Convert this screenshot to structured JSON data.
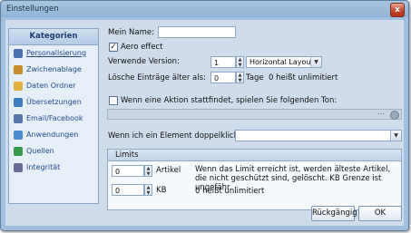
{
  "window": {
    "title": "Einstellungen",
    "close_glyph": "x"
  },
  "sidebar": {
    "header": "Kategorien",
    "items": [
      {
        "label": "Personalisierung",
        "icon": "user-icon",
        "color": "#4a6fb0"
      },
      {
        "label": "Zwichenablage",
        "icon": "clipboard-icon",
        "color": "#c98f2c"
      },
      {
        "label": "Daten Ordner",
        "icon": "folder-icon",
        "color": "#e0b040"
      },
      {
        "label": "Übersetzungen",
        "icon": "translate-icon",
        "color": "#3f7cc4"
      },
      {
        "label": "Email/Facebook",
        "icon": "email-icon",
        "color": "#5577aa"
      },
      {
        "label": "Anwendungen",
        "icon": "applications-icon",
        "color": "#4b8bd0"
      },
      {
        "label": "Quellen",
        "icon": "sources-icon",
        "color": "#3a9a4c"
      },
      {
        "label": "Integrität",
        "icon": "integrity-icon",
        "color": "#6a6a9a"
      }
    ]
  },
  "settings": {
    "name_label": "Mein Name:",
    "name_value": "",
    "aero_label": "Aero effect",
    "aero_checked": "✓",
    "version_label": "Verwende Version:",
    "version_value": "1",
    "layout_value": "Horizontal Layout",
    "delete_label": "Lösche Einträge älter als:",
    "delete_value": "0",
    "delete_unit": "Tage",
    "delete_hint": "0 heißt unlimitiert",
    "sound_label": "Wenn eine Aktion stattfindet, spielen Sie folgenden Ton:",
    "sound_dots": "...",
    "doubleclick_label": "Wenn ich ein Element doppelklicke, bitt",
    "doubleclick_value": ""
  },
  "limits": {
    "title": "Limits",
    "articles_value": "0",
    "articles_label": "Artikel",
    "kb_value": "0",
    "kb_label": "KB",
    "info_text": "Wenn das Limit erreicht ist, werden älteste Artikel, die nicht geschützt sind, gelöscht. KB Grenze ist ungefähr.",
    "kb_hint": "0 heißt unlimitiert"
  },
  "buttons": {
    "reset": "Rückgängig",
    "ok": "OK"
  }
}
